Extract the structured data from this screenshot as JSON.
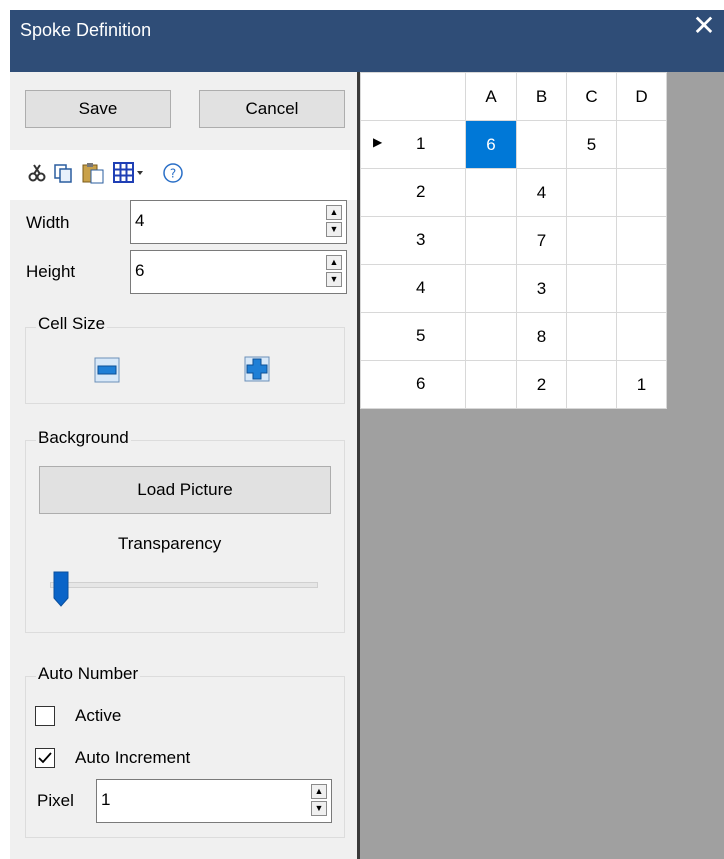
{
  "window": {
    "title": "Spoke Definition",
    "close_glyph": "✕"
  },
  "buttons": {
    "save": "Save",
    "cancel": "Cancel",
    "load_picture": "Load Picture"
  },
  "toolbar": {
    "icons": [
      "cut-icon",
      "copy-icon",
      "paste-icon",
      "grid-dropdown-icon",
      "help-icon"
    ],
    "help_glyph": "?"
  },
  "fields": {
    "width": {
      "label": "Width",
      "value": "4"
    },
    "height": {
      "label": "Height",
      "value": "6"
    }
  },
  "cell_size": {
    "legend": "Cell Size"
  },
  "background": {
    "legend": "Background",
    "transparency_label": "Transparency",
    "transparency_level": 0.0
  },
  "auto_number": {
    "legend": "Auto Number",
    "active_label": "Active",
    "active_checked": false,
    "increment_label": "Auto Increment",
    "increment_checked": true,
    "pixel_label": "Pixel",
    "pixel_value": "1"
  },
  "grid": {
    "columns": [
      "A",
      "B",
      "C",
      "D"
    ],
    "current_row_marker": "▶",
    "rows": [
      {
        "label": "1",
        "cells": [
          "6",
          "",
          "5",
          ""
        ]
      },
      {
        "label": "2",
        "cells": [
          "",
          "4",
          "",
          ""
        ]
      },
      {
        "label": "3",
        "cells": [
          "",
          "7",
          "",
          ""
        ]
      },
      {
        "label": "4",
        "cells": [
          "",
          "3",
          "",
          ""
        ]
      },
      {
        "label": "5",
        "cells": [
          "",
          "8",
          "",
          ""
        ]
      },
      {
        "label": "6",
        "cells": [
          "",
          "2",
          "",
          "1"
        ]
      }
    ],
    "selected_cell": {
      "row": 0,
      "col": 0
    },
    "colors": {
      "selection": "#0078d7",
      "empty_area": "#a0a0a0"
    }
  },
  "colors": {
    "titlebar": "#2f4d77",
    "panel": "#f0f0f0"
  }
}
